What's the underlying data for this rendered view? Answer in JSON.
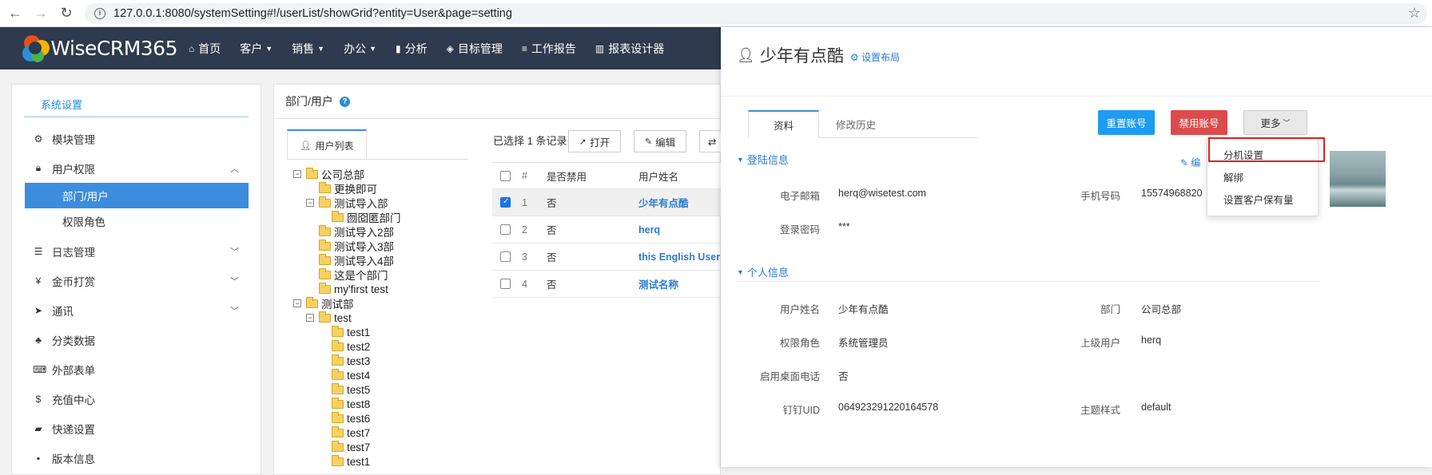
{
  "browser": {
    "url": "127.0.0.1:8080/systemSetting#!/userList/showGrid?entity=User&page=setting"
  },
  "topnav": {
    "logo": "WiseCRM365",
    "items": [
      {
        "label": "首页",
        "icon": "home-icon"
      },
      {
        "label": "客户",
        "caret": true
      },
      {
        "label": "销售",
        "caret": true
      },
      {
        "label": "办公",
        "caret": true
      },
      {
        "label": "分析",
        "icon": "bar-chart-icon"
      },
      {
        "label": "目标管理",
        "icon": "target-icon"
      },
      {
        "label": "工作报告",
        "icon": "list-icon"
      },
      {
        "label": "报表设计器",
        "icon": "building-icon"
      }
    ]
  },
  "sidebar": {
    "title": "系统设置",
    "items": [
      {
        "label": "模块管理"
      },
      {
        "label": "用户权限"
      },
      {
        "label": "部门/用户"
      },
      {
        "label": "权限角色"
      },
      {
        "label": "日志管理"
      },
      {
        "label": "金币打赏"
      },
      {
        "label": "通讯"
      },
      {
        "label": "分类数据"
      },
      {
        "label": "外部表单"
      },
      {
        "label": "充值中心"
      },
      {
        "label": "快递设置"
      },
      {
        "label": "版本信息"
      }
    ]
  },
  "mid": {
    "title": "部门/用户",
    "tree_tab": "用户列表",
    "selection_info": "已选择 1 条记录",
    "btn_open": "打开",
    "btn_edit": "编辑",
    "tree": [
      "公司总部",
      "更换即可",
      "测试导入部",
      "囫囵匿部门",
      "测试导入2部",
      "测试导入3部",
      "测试导入4部",
      "这是个部门",
      "my'first test",
      "测试部",
      "test",
      "test1",
      "test2",
      "test3",
      "test4",
      "test5",
      "test8",
      "test6",
      "test7",
      "test7",
      "test1"
    ],
    "grid": {
      "headers": [
        "#",
        "是否禁用",
        "用户姓名"
      ],
      "rows": [
        {
          "num": "1",
          "disabled": "否",
          "name": "少年有点酷"
        },
        {
          "num": "2",
          "disabled": "否",
          "name": "herq"
        },
        {
          "num": "3",
          "disabled": "否",
          "name": "this English User"
        },
        {
          "num": "4",
          "disabled": "否",
          "name": "测试名称"
        }
      ]
    }
  },
  "drawer": {
    "title": "少年有点酷",
    "layout_link": "设置布局",
    "tab_active": "资料",
    "tab_history": "修改历史",
    "btn_reset": "重置账号",
    "btn_disable": "禁用账号",
    "btn_more": "更多",
    "edit_link": "编",
    "section_login": "登陆信息",
    "section_personal": "个人信息",
    "fields": {
      "email_label": "电子邮箱",
      "email": "herq@wisetest.com",
      "phone_label": "手机号码",
      "phone": "15574968820",
      "pwd_label": "登录密码",
      "pwd": "***",
      "username_label": "用户姓名",
      "username": "少年有点酷",
      "dept_label": "部门",
      "dept": "公司总部",
      "role_label": "权限角色",
      "role": "系统管理员",
      "super_label": "上级用户",
      "super": "herq",
      "desk_label": "启用桌面电话",
      "desk": "否",
      "ding_label": "钉钉UID",
      "ding": "064923291220164578",
      "theme_label": "主题样式",
      "theme": "default"
    },
    "more_menu": [
      "分机设置",
      "解绑",
      "设置客户保有量"
    ]
  },
  "colors": {
    "nav_bg": "#2e3a4d",
    "active_blue": "#3c8dde",
    "btn_reset": "#1e9cf0",
    "btn_disable": "#dc4b4b",
    "highlight": "#e02020"
  }
}
